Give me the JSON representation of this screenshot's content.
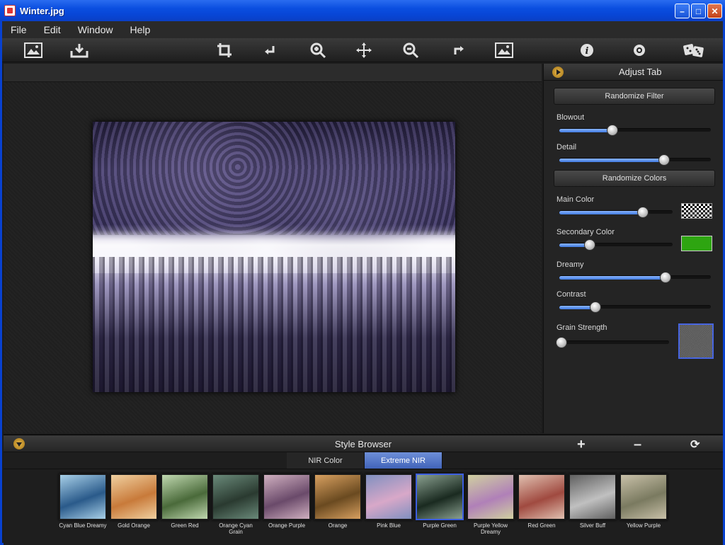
{
  "window": {
    "title": "Winter.jpg",
    "title_buttons": [
      "minimize-icon",
      "maximize-icon",
      "close-icon"
    ]
  },
  "menu": {
    "items": [
      "File",
      "Edit",
      "Window",
      "Help"
    ]
  },
  "toolbar": {
    "tools": [
      {
        "name": "open-image-icon"
      },
      {
        "name": "save-icon"
      },
      {
        "name": "crop-icon"
      },
      {
        "name": "rotate-left-icon"
      },
      {
        "name": "zoom-in-icon"
      },
      {
        "name": "pan-icon"
      },
      {
        "name": "zoom-out-icon"
      },
      {
        "name": "rotate-right-icon"
      },
      {
        "name": "fit-image-icon"
      },
      {
        "name": "info-icon"
      },
      {
        "name": "settings-icon"
      },
      {
        "name": "randomize-dice-icon"
      }
    ]
  },
  "adjust": {
    "title": "Adjust Tab",
    "randomize_filter": "Randomize Filter",
    "randomize_colors": "Randomize Colors",
    "sliders": {
      "blowout": {
        "label": "Blowout",
        "value": 0.35
      },
      "detail": {
        "label": "Detail",
        "value": 0.69
      },
      "main_color": {
        "label": "Main Color",
        "value": 0.74
      },
      "secondary_color": {
        "label": "Secondary Color",
        "value": 0.27
      },
      "dreamy": {
        "label": "Dreamy",
        "value": 0.7
      },
      "contrast": {
        "label": "Contrast",
        "value": 0.24
      },
      "grain_strength": {
        "label": "Grain Strength",
        "value": 0.02
      }
    },
    "colors": {
      "main_swatch": "checkerboard",
      "secondary_swatch": "#2ea511"
    }
  },
  "style_browser": {
    "title": "Style Browser",
    "tabs": [
      "NIR Color",
      "Extreme NIR"
    ],
    "active_tab": "Extreme NIR",
    "buttons": [
      "add-icon",
      "remove-icon",
      "reset-icon"
    ],
    "styles": [
      {
        "label": "Cyan Blue Dreamy",
        "colors": [
          "#2a5a8a",
          "#a8d0e8"
        ]
      },
      {
        "label": "Gold Orange",
        "colors": [
          "#c87a3a",
          "#f0d0a0"
        ]
      },
      {
        "label": "Green Red",
        "colors": [
          "#4a6a3a",
          "#c0d8b0"
        ]
      },
      {
        "label": "Orange Cyan Grain",
        "colors": [
          "#2a3a30",
          "#6a8a7a"
        ]
      },
      {
        "label": "Orange Purple",
        "colors": [
          "#6a4a6a",
          "#d0b0c0"
        ]
      },
      {
        "label": "Orange",
        "colors": [
          "#6a4a20",
          "#d8a060"
        ]
      },
      {
        "label": "Pink Blue",
        "colors": [
          "#d8a8c8",
          "#8090c0"
        ]
      },
      {
        "label": "Purple Green",
        "colors": [
          "#1a2a20",
          "#8aa090"
        ]
      },
      {
        "label": "Purple Yellow Dreamy",
        "colors": [
          "#b080b8",
          "#d0d0a0"
        ]
      },
      {
        "label": "Red Green",
        "colors": [
          "#a04a40",
          "#e0c0b0"
        ]
      },
      {
        "label": "Silver Buff",
        "colors": [
          "#c0c0c0",
          "#606060"
        ]
      },
      {
        "label": "Yellow Purple",
        "colors": [
          "#7a7a60",
          "#c8c0a8"
        ]
      }
    ],
    "selected_style": "Purple Green"
  }
}
